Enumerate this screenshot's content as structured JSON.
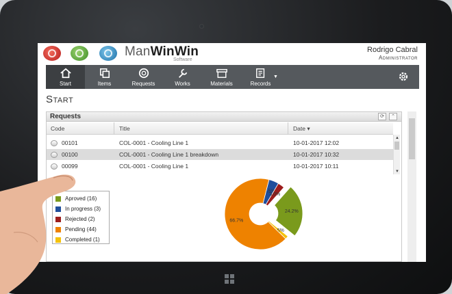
{
  "header": {
    "brand_strong": "ManWinWin",
    "brand_prefix": "Man",
    "brand_suffix": "WinWin",
    "brand_sub": "Software",
    "user_name": "Rodrigo Cabral",
    "user_role": "Administrator"
  },
  "nav": {
    "items": [
      {
        "label": "Start",
        "icon": "home-icon"
      },
      {
        "label": "Items",
        "icon": "items-icon"
      },
      {
        "label": "Requests",
        "icon": "lifebuoy-icon"
      },
      {
        "label": "Works",
        "icon": "wrench-icon"
      },
      {
        "label": "Materials",
        "icon": "box-icon"
      },
      {
        "label": "Records",
        "icon": "records-icon"
      }
    ],
    "settings_icon": "gear-icon"
  },
  "page": {
    "title": "Start"
  },
  "requests_panel": {
    "title": "Requests",
    "columns": [
      "Code",
      "Title",
      "Date ▾"
    ],
    "rows": [
      {
        "code": "00101",
        "title": "COL-0001 - Cooling Line 1",
        "date": "10-01-2017 12:02"
      },
      {
        "code": "00100",
        "title": "COL-0001 - Cooling Line 1 breakdown",
        "date": "10-01-2017 10:32"
      },
      {
        "code": "00099",
        "title": "COL-0001 - Cooling Line 1",
        "date": "10-01-2017 10:11"
      }
    ]
  },
  "chart_data": {
    "type": "pie",
    "slices": [
      {
        "label": "Aproved (16)",
        "value": 16,
        "percent_label": "24.2%",
        "color": "#7a9a1c"
      },
      {
        "label": "In progress (3)",
        "value": 3,
        "percent_label": "4.5%",
        "color": "#1f4e9c"
      },
      {
        "label": "Rejected (2)",
        "value": 2,
        "percent_label": "3.0%",
        "color": "#9c1c1c"
      },
      {
        "label": "Pending (44)",
        "value": 44,
        "percent_label": "66.7%",
        "color": "#ee8200"
      },
      {
        "label": "Completed (1)",
        "value": 1,
        "percent_label": "1.5%",
        "color": "#f4c20d"
      }
    ],
    "legend_position": "left"
  }
}
